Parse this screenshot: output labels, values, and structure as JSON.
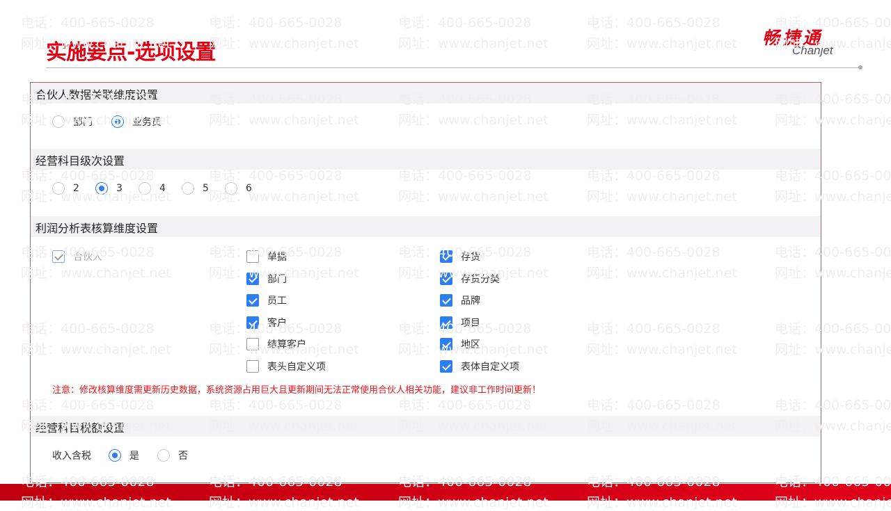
{
  "watermark": {
    "phone": "电话：400-665-0028",
    "url": "网址：www.chanjet.net"
  },
  "header": {
    "title": "实施要点-选项设置",
    "logo_cn": "畅捷通",
    "logo_en": "Chanjet"
  },
  "sections": {
    "partner": {
      "title": "合伙人数据关联维度设置",
      "options": [
        {
          "label": "部门",
          "selected": false
        },
        {
          "label": "业务员",
          "selected": true
        }
      ]
    },
    "levels": {
      "title": "经营科目级次设置",
      "options": [
        {
          "label": "2",
          "selected": false
        },
        {
          "label": "3",
          "selected": true
        },
        {
          "label": "4",
          "selected": false
        },
        {
          "label": "5",
          "selected": false
        },
        {
          "label": "6",
          "selected": false
        }
      ]
    },
    "profit": {
      "title": "利润分析表核算维度设置",
      "fixed": {
        "label": "合伙人",
        "checked": true,
        "disabled": true
      },
      "col2": [
        {
          "label": "单据",
          "checked": false
        },
        {
          "label": "部门",
          "checked": true
        },
        {
          "label": "员工",
          "checked": true
        },
        {
          "label": "客户",
          "checked": true
        },
        {
          "label": "结算客户",
          "checked": false
        },
        {
          "label": "表头自定义项",
          "checked": false
        }
      ],
      "col3": [
        {
          "label": "存货",
          "checked": true
        },
        {
          "label": "存货分类",
          "checked": true
        },
        {
          "label": "品牌",
          "checked": true
        },
        {
          "label": "项目",
          "checked": true
        },
        {
          "label": "地区",
          "checked": true
        },
        {
          "label": "表体自定义项",
          "checked": true
        }
      ],
      "warning": "注意：修改核算维度需更新历史数据，系统资源占用巨大且更新期间无法正常使用合伙人相关功能，建议非工作时间更新！"
    },
    "tax": {
      "title": "经营科目税额设置",
      "field_label": "收入含税",
      "options": [
        {
          "label": "是",
          "selected": true
        },
        {
          "label": "否",
          "selected": false
        }
      ]
    }
  },
  "colors": {
    "accent": "#2d7ff0",
    "brand": "#e00012"
  }
}
